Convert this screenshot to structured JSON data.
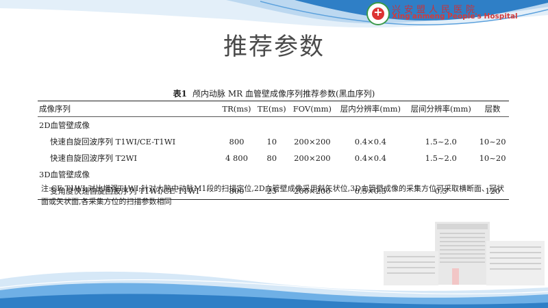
{
  "header": {
    "hospital_cn": "兴安盟人民医院",
    "hospital_en": "Xing'anmeng People's Hospital"
  },
  "slide": {
    "title": "推荐参数"
  },
  "table": {
    "number": "表1",
    "caption": "颅内动脉 MR 血管壁成像序列推荐参数(黑血序列)",
    "columns": [
      "成像序列",
      "TR(ms)",
      "TE(ms)",
      "FOV(mm)",
      "层内分辨率(mm)",
      "层间分辨率(mm)",
      "层数"
    ],
    "group_2d": "2D血管壁成像",
    "group_3d": "3D血管壁成像",
    "rows": [
      [
        "快速自旋回波序列 T1WI/CE-T1WI",
        "800",
        "10",
        "200×200",
        "0.4×0.4",
        "1.5~2.0",
        "10~20"
      ],
      [
        "快速自旋回波序列 T2WI",
        "4 800",
        "80",
        "200×200",
        "0.4×0.4",
        "1.5~2.0",
        "10~20"
      ],
      [
        "变角度快速自旋回波序列 T1WI/CE-T1WI",
        "800",
        "25",
        "200×200",
        "0.5×0.5",
        "0.5",
        "120"
      ]
    ],
    "note": "注:CE-T1WI:对比增强T1WI;针对大脑中动脉M1段的扫描定位,2D血管壁成像采用斜矢状位,3D血管壁成像的采集方位可采取横断面、冠状面或矢状面,各采集方位的扫描参数相同"
  },
  "colors": {
    "accent": "#2f7fc6",
    "wave_light": "#bcd8f0"
  }
}
